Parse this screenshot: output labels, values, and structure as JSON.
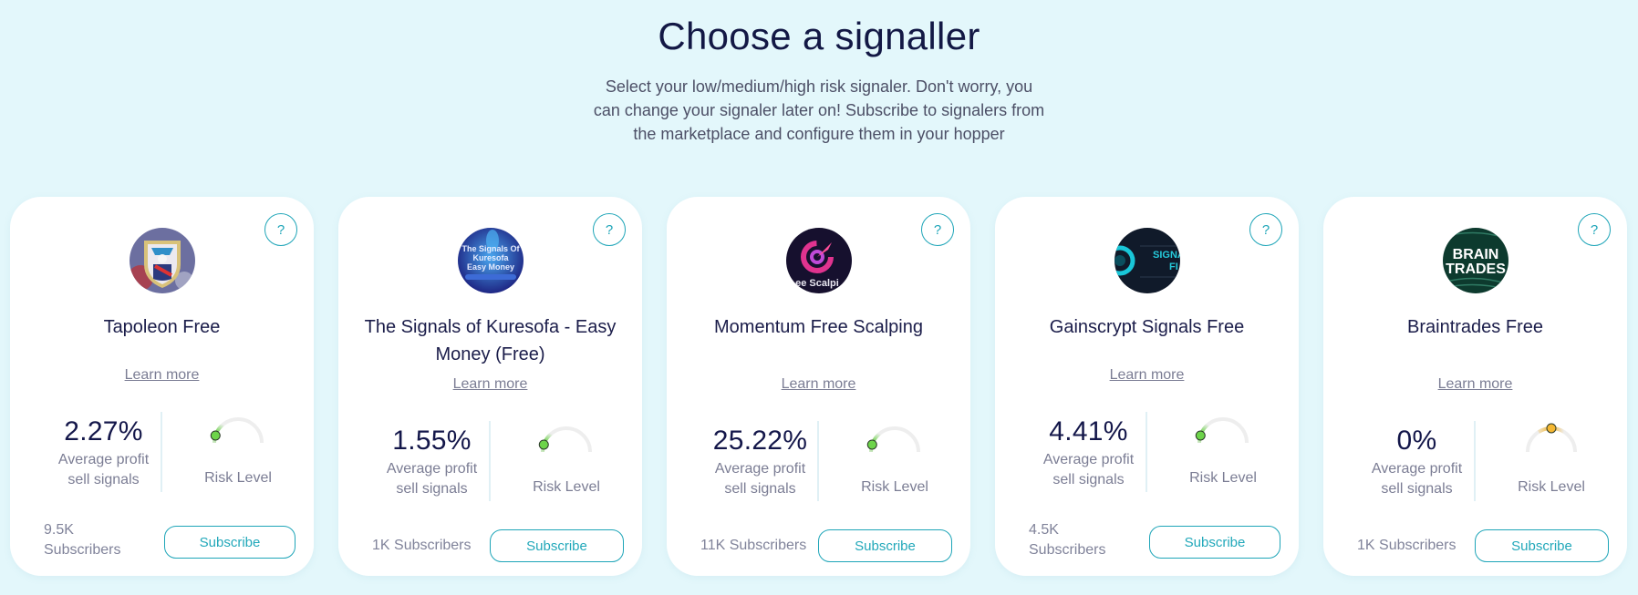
{
  "header": {
    "title": "Choose a signaller",
    "subtitle": "Select your low/medium/high risk signaler. Don't worry, you can change your signaler later on! Subscribe to signalers from the marketplace and configure them in your hopper"
  },
  "colors": {
    "background": "#e3f7fb",
    "accent": "#1ea5b8",
    "title_text": "#131845",
    "muted_text": "#7b7d94",
    "risk_low": "#6dd44a",
    "risk_medium": "#f5b731"
  },
  "labels": {
    "help": "?",
    "learn_more": "Learn more",
    "profit_label_line1": "Average profit",
    "profit_label_line2": "sell signals",
    "risk_label": "Risk Level",
    "subscribe": "Subscribe"
  },
  "signallers": [
    {
      "name": "Tapoleon Free",
      "avatar_icon": "napoleon-shield-logo",
      "avg_profit": "2.27%",
      "risk_level": 0.1,
      "risk_category": "low",
      "subscribers": "9.5K Subscribers"
    },
    {
      "name": "The Signals of Kuresofa - Easy Money (Free)",
      "avatar_icon": "kuresofa-easy-money-logo",
      "avg_profit": "1.55%",
      "risk_level": 0.1,
      "risk_category": "low",
      "subscribers": "1K Subscribers"
    },
    {
      "name": "Momentum Free Scalping",
      "avatar_icon": "momentum-target-logo",
      "avg_profit": "25.22%",
      "risk_level": 0.1,
      "risk_category": "low",
      "subscribers": "11K Subscribers"
    },
    {
      "name": "Gainscrypt Signals Free",
      "avatar_icon": "gainscrypt-signals-logo",
      "avg_profit": "4.41%",
      "risk_level": 0.1,
      "risk_category": "low",
      "subscribers": "4.5K Subscribers"
    },
    {
      "name": "Braintrades Free",
      "avatar_icon": "braintrades-logo",
      "avg_profit": "0%",
      "risk_level": 0.5,
      "risk_category": "medium",
      "subscribers": "1K Subscribers"
    }
  ]
}
